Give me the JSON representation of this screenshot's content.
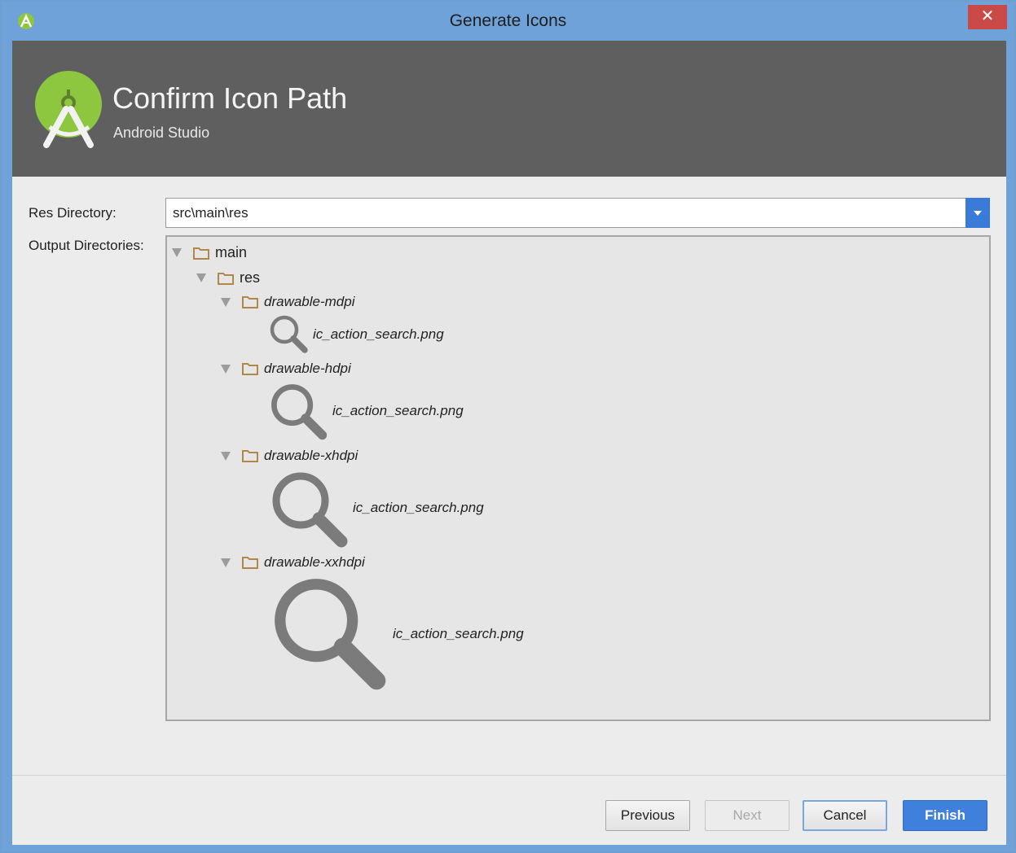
{
  "window": {
    "title": "Generate Icons",
    "close_glyph": "✕"
  },
  "header": {
    "title": "Confirm Icon Path",
    "subtitle": "Android Studio"
  },
  "form": {
    "res_directory_label": "Res Directory:",
    "res_directory_value": "src\\main\\res",
    "output_directories_label": "Output Directories:"
  },
  "tree": {
    "root": "main",
    "res": "res",
    "folders": [
      {
        "name": "drawable-mdpi",
        "file": "ic_action_search.png"
      },
      {
        "name": "drawable-hdpi",
        "file": "ic_action_search.png"
      },
      {
        "name": "drawable-xhdpi",
        "file": "ic_action_search.png"
      },
      {
        "name": "drawable-xxhdpi",
        "file": "ic_action_search.png"
      }
    ]
  },
  "buttons": {
    "previous": "Previous",
    "next": "Next",
    "cancel": "Cancel",
    "finish": "Finish"
  },
  "colors": {
    "accent": "#3f80dc",
    "header_bg": "#5f5f5f",
    "android_green": "#8dc63f",
    "folder": "#b2884a",
    "close": "#c94a47"
  }
}
